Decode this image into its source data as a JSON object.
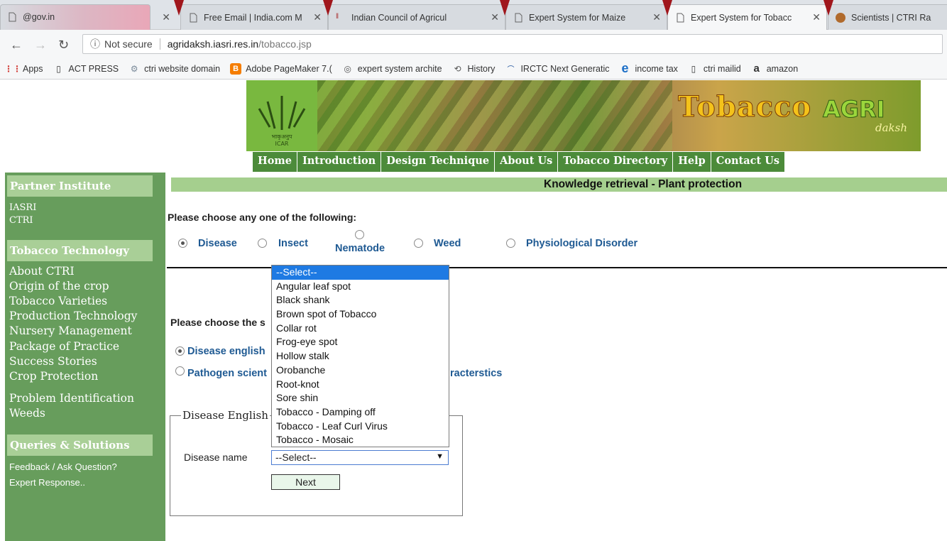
{
  "browser": {
    "tabs": [
      {
        "title": "@gov.in"
      },
      {
        "title": "Free Email | India.com M"
      },
      {
        "title": "Indian Council of Agricul"
      },
      {
        "title": "Expert System for Maize"
      },
      {
        "title": "Expert System for Tobacc"
      },
      {
        "title": "Scientists | CTRI Ra"
      }
    ],
    "security_label": "Not secure",
    "url_host": "agridaksh.iasri.res.in",
    "url_path": "/tobacco.jsp",
    "bookmarks": [
      {
        "label": "Apps",
        "icon": "apps-grid-icon"
      },
      {
        "label": "ACT PRESS",
        "icon": "page-icon"
      },
      {
        "label": "ctri website domain",
        "icon": "gear-globe-icon"
      },
      {
        "label": "Adobe PageMaker 7.(",
        "icon": "blogger-icon"
      },
      {
        "label": "expert system archite",
        "icon": "swirl-icon"
      },
      {
        "label": "History",
        "icon": "history-icon"
      },
      {
        "label": "IRCTC Next Generatic",
        "icon": "irctc-icon"
      },
      {
        "label": "income tax",
        "icon": "ie-icon"
      },
      {
        "label": "ctri mailid",
        "icon": "page-icon"
      },
      {
        "label": "amazon",
        "icon": "amazon-icon"
      }
    ]
  },
  "banner": {
    "brand": "Tobacco",
    "agri": "AGRI",
    "daksh": "daksh",
    "logo_text": "भाकृअनुप\nICAR"
  },
  "topnav": [
    "Home",
    "Introduction",
    "Design Technique",
    "About Us",
    "Tobacco Directory",
    "Help",
    "Contact Us"
  ],
  "sidebar": {
    "partner_heading": "Partner Institute",
    "partners": [
      "IASRI",
      "CTRI"
    ],
    "tech_heading": "Tobacco Technology",
    "tech_links": [
      "About CTRI",
      "Origin of the crop",
      "Tobacco Varieties",
      "Production Technology",
      "Nursery Management",
      "Package of Practice",
      "Success Stories",
      "Crop Protection"
    ],
    "extra_links": [
      "Problem Identification",
      "Weeds"
    ],
    "queries_heading": "Queries & Solutions",
    "query_links": [
      "Feedback / Ask Question?",
      "Expert Response.."
    ]
  },
  "main": {
    "section_title": "Knowledge retrieval - Plant protection",
    "choose_prompt": "Please choose any one of the following:",
    "categories": [
      {
        "label": "Disease",
        "checked": true
      },
      {
        "label": "Insect",
        "checked": false
      },
      {
        "label": "Nematode",
        "checked": false
      },
      {
        "label": "Weed",
        "checked": false
      },
      {
        "label": "Physiological Disorder",
        "checked": false
      }
    ],
    "search_prompt": "Please choose the s",
    "search_options": [
      {
        "label": "Disease english",
        "checked": true
      },
      {
        "label": "Pathogen scient",
        "checked": false
      }
    ],
    "search_option_tail": "racterstics",
    "fieldset_legend": "Disease English",
    "disease_label": "Disease name",
    "select_value": "--Select--",
    "next_label": "Next",
    "dropdown_options": [
      "--Select--",
      "Angular leaf spot",
      "Black shank",
      "Brown spot of Tobacco",
      "Collar rot",
      "Frog-eye spot",
      "Hollow stalk",
      "Orobanche",
      "Root-knot",
      "Sore shin",
      "Tobacco - Damping off",
      "Tobacco - Leaf Curl Virus",
      "Tobacco - Mosaic"
    ],
    "dropdown_selected_index": 0
  },
  "colors": {
    "sidebar_bg": "#679d5c",
    "sidebar_heading": "#a9cf97",
    "nav_bg": "#4c8b3a",
    "section_bar": "#a5cf8e",
    "link_blue": "#1f5a93",
    "highlight": "#1e7ae3"
  }
}
